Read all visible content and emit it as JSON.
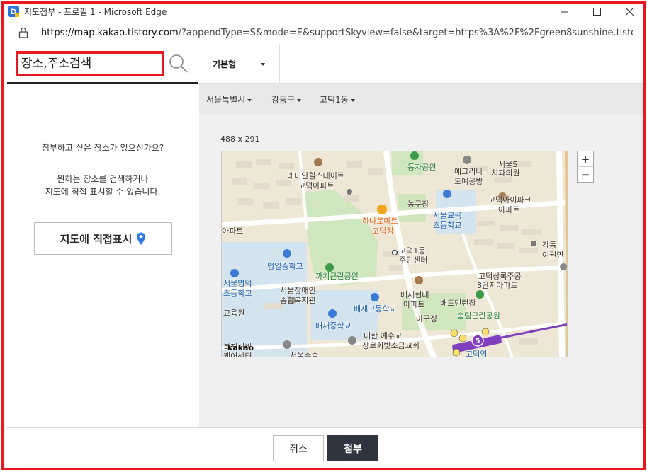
{
  "window": {
    "title": "지도첨부 - 프로필 1 - Microsoft Edge",
    "url_host": "https://map.kakao.tistory.com",
    "url_rest": "/?appendType=S&mode=E&supportSkyview=false&target=https%3A%2F%2Fgreen8sunshine.tistory.c..."
  },
  "search": {
    "placeholder": "장소,주소검색"
  },
  "left_panel": {
    "prompt": "첨부하고 싶은 장소가 있으신가요?",
    "hint_line1": "원하는 장소를 검색하거나",
    "hint_line2": "지도에 직접 표시할 수 있습니다.",
    "direct_button": "지도에 직접표시"
  },
  "map_type": {
    "selected": "기본형"
  },
  "regions": [
    "서울특별시",
    "강동구",
    "고덕1동"
  ],
  "map": {
    "size_label": "488 x 291",
    "brand": "kakao",
    "zoom_in": "+",
    "zoom_out": "−",
    "labels": [
      {
        "text": "동자공원",
        "type": "green"
      },
      {
        "text": "예그리나",
        "type": "dark"
      },
      {
        "text": "도예공방",
        "type": "dark"
      },
      {
        "text": "서울S",
        "type": "dark"
      },
      {
        "text": "치과의원",
        "type": "dark"
      },
      {
        "text": "래미안힐스테이트",
        "type": "dark"
      },
      {
        "text": "고덕아파트",
        "type": "dark"
      },
      {
        "text": "고덕아이파크",
        "type": "dark"
      },
      {
        "text": "아파트",
        "type": "dark"
      },
      {
        "text": "농구장",
        "type": "dark"
      },
      {
        "text": "서울묘곡",
        "type": "blue"
      },
      {
        "text": "초등학교",
        "type": "blue"
      },
      {
        "text": "하나로마트",
        "type": "orange"
      },
      {
        "text": "고덕점",
        "type": "orange"
      },
      {
        "text": "아파트",
        "type": "dark"
      },
      {
        "text": "고덕1동",
        "type": "dark"
      },
      {
        "text": "주민센터",
        "type": "dark"
      },
      {
        "text": "강동",
        "type": "dark"
      },
      {
        "text": "여권민",
        "type": "dark"
      },
      {
        "text": "명일중학교",
        "type": "blue"
      },
      {
        "text": "까치근린공원",
        "type": "green"
      },
      {
        "text": "고덕상록주공",
        "type": "dark"
      },
      {
        "text": "8단지아파트",
        "type": "dark"
      },
      {
        "text": "서울명덕",
        "type": "blue"
      },
      {
        "text": "초등학교",
        "type": "blue"
      },
      {
        "text": "서울장애인",
        "type": "dark"
      },
      {
        "text": "종합복지관",
        "type": "dark"
      },
      {
        "text": "배재현대",
        "type": "dark"
      },
      {
        "text": "아파트",
        "type": "dark"
      },
      {
        "text": "배드민턴장",
        "type": "dark"
      },
      {
        "text": "배재고등학교",
        "type": "blue"
      },
      {
        "text": "교육원",
        "type": "dark"
      },
      {
        "text": "아구장",
        "type": "dark"
      },
      {
        "text": "송림근린공원",
        "type": "green"
      },
      {
        "text": "배재중학교",
        "type": "blue"
      },
      {
        "text": "대한 예수교",
        "type": "dark"
      },
      {
        "text": "장로회빛소금교회",
        "type": "dark"
      },
      {
        "text": "복지시비",
        "type": "dark"
      },
      {
        "text": "케어센터",
        "type": "dark"
      },
      {
        "text": "서울수줄",
        "type": "dark"
      },
      {
        "text": "고덕역",
        "type": "blue"
      }
    ]
  },
  "footer": {
    "cancel": "취소",
    "attach": "첨부"
  },
  "colors": {
    "highlight_red": "#e8191e",
    "attach_button": "#2f3440",
    "map_blue": "#1b5ea8",
    "map_green": "#1f7a2e",
    "metro_line5": "#7f3fbf"
  }
}
